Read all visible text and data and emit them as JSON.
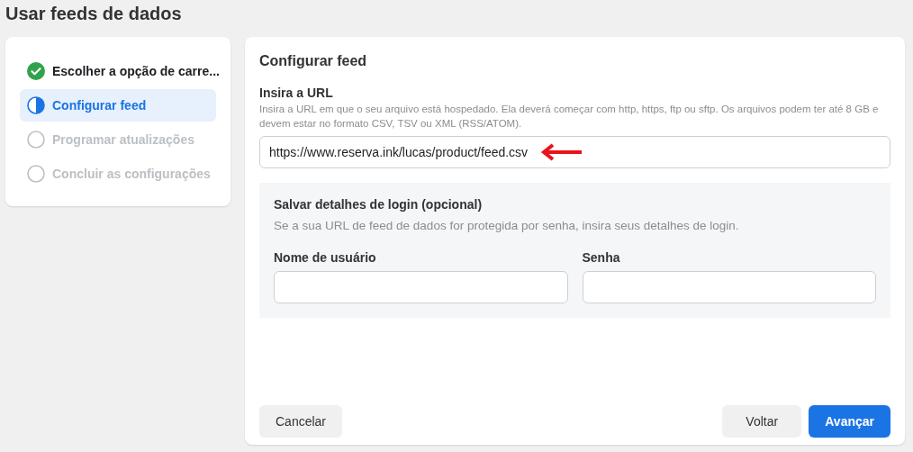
{
  "page_title": "Usar feeds de dados",
  "steps": [
    {
      "label": "Escolher a opção de carre...",
      "kind": "done",
      "selected": false
    },
    {
      "label": "Configurar feed",
      "kind": "current",
      "selected": true
    },
    {
      "label": "Programar atualizações",
      "kind": "pending",
      "selected": false
    },
    {
      "label": "Concluir as configurações",
      "kind": "pending",
      "selected": false
    }
  ],
  "panel": {
    "title": "Configurar feed",
    "url_field": {
      "label": "Insira a URL",
      "help": "Insira a URL em que o seu arquivo está hospedado. Ela deverá começar com http, https, ftp ou sftp. Os arquivos podem ter até 8 GB e devem estar no formato CSV, TSV ou XML (RSS/ATOM).",
      "value": "https://www.reserva.ink/lucas/product/feed.csv"
    },
    "login": {
      "title": "Salvar detalhes de login (opcional)",
      "help": "Se a sua URL de feed de dados for protegida por senha, insira seus detalhes de login.",
      "fields": [
        {
          "label": "Nome de usuário"
        },
        {
          "label": "Senha"
        }
      ]
    }
  },
  "buttons": [
    {
      "label": "Cancelar",
      "kind": "secondary"
    },
    {
      "label": "Voltar",
      "kind": "secondary"
    },
    {
      "label": "Avançar",
      "kind": "primary"
    }
  ]
}
